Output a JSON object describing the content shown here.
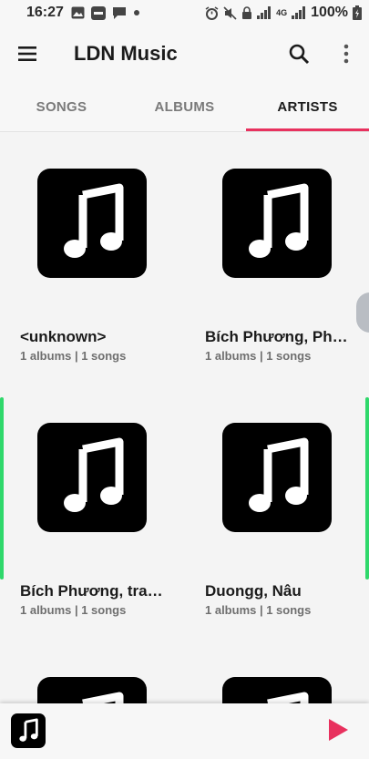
{
  "status_bar": {
    "time": "16:27",
    "battery": "100%",
    "network": "4G",
    "icons": [
      "image-icon",
      "zalo-icon",
      "message-icon",
      "dot-icon",
      "alarm-icon",
      "mute-icon",
      "lock-icon",
      "signal-icon",
      "signal-icon",
      "battery-icon"
    ]
  },
  "app_bar": {
    "title": "LDN Music",
    "icons": [
      "menu-icon",
      "search-icon",
      "more-vert-icon"
    ]
  },
  "tabs": [
    {
      "label": "SONGS"
    },
    {
      "label": "ALBUMS"
    },
    {
      "label": "ARTISTS",
      "active": true
    }
  ],
  "artists": [
    {
      "name": "<unknown>",
      "meta": "1 albums | 1 songs"
    },
    {
      "name": "Bích Phương, Phú…",
      "meta": "1 albums | 1 songs"
    },
    {
      "name": "Bích Phương, trait…",
      "meta": "1 albums | 1 songs"
    },
    {
      "name": "Duongg, Nâu",
      "meta": "1 albums | 1 songs"
    },
    {
      "name": "",
      "meta": ""
    },
    {
      "name": "",
      "meta": ""
    }
  ],
  "player": {
    "icons": [
      "music-note-icon",
      "play-icon"
    ]
  },
  "colors": {
    "accent": "#e8315e",
    "edge_indicator": "#2fd86b",
    "thumb_bg": "#000000",
    "background": "#f4f4f4"
  }
}
